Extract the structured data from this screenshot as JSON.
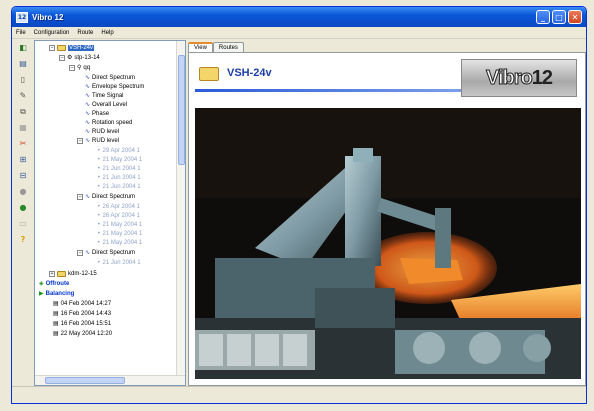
{
  "window": {
    "title": "Vibro 12",
    "icon_text": "12",
    "minimize_glyph": "_",
    "maximize_glyph": "□",
    "close_glyph": "✕"
  },
  "menu": [
    "File",
    "Configuration",
    "Route",
    "Help"
  ],
  "toolbar_icons": [
    "exit-icon",
    "open-icon",
    "new-icon",
    "edit-icon",
    "copy-icon",
    "paste-icon",
    "delete-icon",
    "expand-icon",
    "collapse-icon",
    "record-icon",
    "settings-icon",
    "help-icon"
  ],
  "toolbar_glyphs": [
    "◧",
    "▤",
    "▯",
    "✎",
    "⧉",
    "▦",
    "✂",
    "⊞",
    "⊟",
    "●",
    "▭",
    "?"
  ],
  "tree": {
    "root": "VSH-24v",
    "machine": "stp-13-14",
    "point": "qq",
    "measurements": [
      "Direct Spectrum",
      "Envelope Spectrum",
      "Time Signal",
      "Overall Level",
      "Phase",
      "Rotation speed",
      "RUD level",
      "RUD level"
    ],
    "rud_dates": [
      "29 Apr 2004 1",
      "21 May 2004 1",
      "21 Jun 2004 1",
      "21 Jun 2004 1",
      "21 Jun 2004 1"
    ],
    "direct_spectrum_1": "Direct Spectrum",
    "ds1_dates": [
      "26 Apr 2004 1",
      "26 Apr 2004 1",
      "21 May 2004 1",
      "21 May 2004 1",
      "21 May 2004 1"
    ],
    "direct_spectrum_2": "Direct Spectrum",
    "ds2_dates": [
      "21 Jun 2004 1"
    ],
    "second_machine": "kdm-12-15",
    "offroute": "Offroute",
    "balancing": "Balancing",
    "balancing_dates": [
      "04 Feb 2004 14:27",
      "16 Feb 2004 14:43",
      "16 Feb 2004 15:51",
      "22 May 2004 12:20"
    ]
  },
  "tabs": [
    "View",
    "Routes"
  ],
  "header": {
    "title": "VSH-24v"
  },
  "logo": {
    "text_a": "Vibro",
    "text_b": "12"
  },
  "colors": {
    "title_bar": "#0a57d8",
    "selection": "#316ac5",
    "header_text": "#1a3ea8",
    "molten": "#f07a1c"
  }
}
